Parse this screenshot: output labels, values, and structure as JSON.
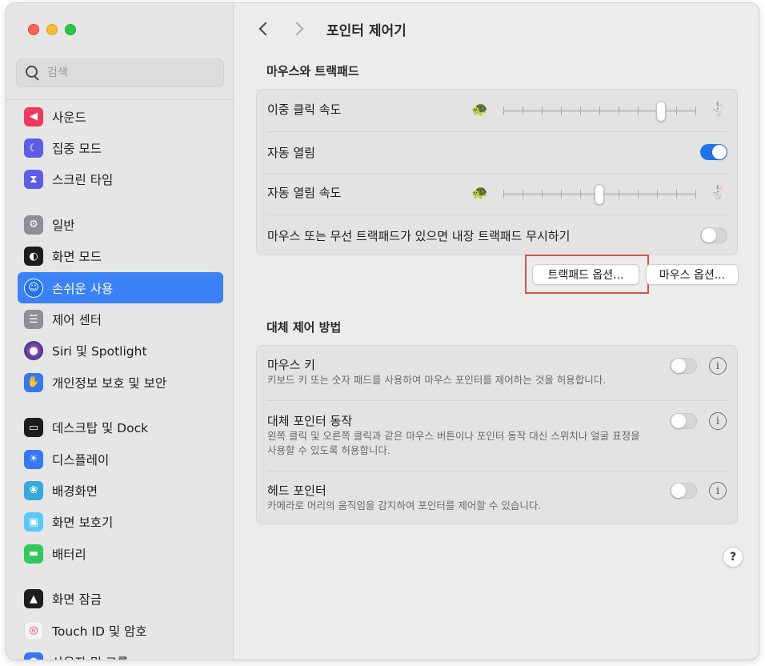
{
  "sidebar": {
    "search_placeholder": "검색",
    "items": [
      {
        "label": "사운드",
        "icon": "speaker-icon",
        "color": "#f0395a"
      },
      {
        "label": "집중 모드",
        "icon": "moon-icon",
        "color": "#5e5ce6"
      },
      {
        "label": "스크린 타임",
        "icon": "hourglass-icon",
        "color": "#5e5ce6"
      },
      {
        "label": "일반",
        "icon": "gear-icon",
        "color": "#8e8e93"
      },
      {
        "label": "화면 모드",
        "icon": "appearance-icon",
        "color": "#1d1d1f"
      },
      {
        "label": "손쉬운 사용",
        "icon": "accessibility-icon",
        "color": "#1e74e8"
      },
      {
        "label": "제어 센터",
        "icon": "control-center-icon",
        "color": "#8e8e93"
      },
      {
        "label": "Siri 및 Spotlight",
        "icon": "siri-icon",
        "color": "#3a3a8c"
      },
      {
        "label": "개인정보 보호 및 보안",
        "icon": "hand-icon",
        "color": "#3478f6"
      },
      {
        "label": "데스크탑 및 Dock",
        "icon": "dock-icon",
        "color": "#1d1d1f"
      },
      {
        "label": "디스플레이",
        "icon": "sun-icon",
        "color": "#3478f6"
      },
      {
        "label": "배경화면",
        "icon": "flower-icon",
        "color": "#34aadc"
      },
      {
        "label": "화면 보호기",
        "icon": "screensaver-icon",
        "color": "#5ac8fa"
      },
      {
        "label": "배터리",
        "icon": "battery-icon",
        "color": "#34c759"
      },
      {
        "label": "화면 잠금",
        "icon": "lock-icon",
        "color": "#1d1d1f"
      },
      {
        "label": "Touch ID 및 암호",
        "icon": "fingerprint-icon",
        "color": "#f2f2f7"
      },
      {
        "label": "사용자 및 그룹",
        "icon": "users-icon",
        "color": "#3478f6"
      }
    ]
  },
  "header": {
    "title": "포인터 제어기"
  },
  "mouse_trackpad": {
    "section_title": "마우스와 트랙패드",
    "double_click_speed": {
      "label": "이중 클릭 속도",
      "value": 0.82
    },
    "spring_loading": {
      "label": "자동 열림",
      "on": true
    },
    "spring_loading_speed": {
      "label": "자동 열림 속도",
      "value": 0.5
    },
    "ignore_builtin": {
      "label": "마우스 또는 무선 트랙패드가 있으면 내장 트랙패드 무시하기",
      "on": false
    },
    "trackpad_options_button": "트랙패드 옵션...",
    "mouse_options_button": "마우스 옵션..."
  },
  "alternate_control": {
    "section_title": "대체 제어 방법",
    "mouse_keys": {
      "label": "마우스 키",
      "desc": "키보드 키 또는 숫자 패드를 사용하여 마우스 포인터를 제어하는 것을 허용합니다.",
      "on": false
    },
    "alt_pointer": {
      "label": "대체 포인터 동작",
      "desc": "왼쪽 클릭 및 오른쪽 클릭과 같은 마우스 버튼이나 포인터 동작 대신 스위치나 얼굴 표정을 사용할 수 있도록 허용합니다.",
      "on": false
    },
    "head_pointer": {
      "label": "헤드 포인터",
      "desc": "카메라로 머리의 움직임을 감지하여 포인터를 제어할 수 있습니다.",
      "on": false
    }
  },
  "help_label": "?",
  "colors": {
    "accent": "#1e74e8",
    "highlight": "#d5553f"
  }
}
